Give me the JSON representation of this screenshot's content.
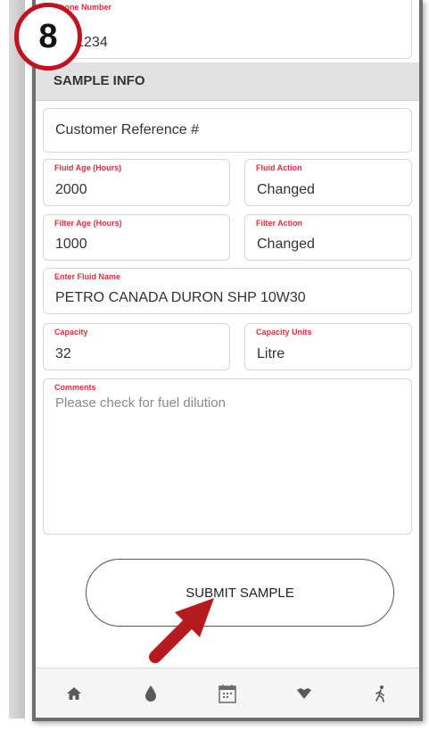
{
  "phone_field": {
    "label": "Phone Number",
    "value": "56-1234"
  },
  "section_title": "SAMPLE INFO",
  "customer_ref": {
    "value": "Customer Reference #"
  },
  "fluid_age": {
    "label": "Fluid Age (Hours)",
    "value": "2000"
  },
  "fluid_action": {
    "label": "Fluid Action",
    "value": "Changed"
  },
  "filter_age": {
    "label": "Filter Age (Hours)",
    "value": "1000"
  },
  "filter_action": {
    "label": "Filter Action",
    "value": "Changed"
  },
  "fluid_name": {
    "label": "Enter Fluid Name",
    "value": "PETRO CANADA DURON SHP 10W30"
  },
  "capacity": {
    "label": "Capacity",
    "value": "32"
  },
  "capacity_units": {
    "label": "Capacity Units",
    "value": "Litre"
  },
  "comments": {
    "label": "Comments",
    "placeholder": "Please check for fuel dilution"
  },
  "submit_label": "SUBMIT SAMPLE",
  "nav": [
    {
      "icon": "home-icon"
    },
    {
      "icon": "drop-icon"
    },
    {
      "icon": "calendar-icon"
    },
    {
      "icon": "heart-icon"
    },
    {
      "icon": "walk-icon"
    }
  ],
  "step_badge": "8",
  "colors": {
    "label_red": "#e0303c",
    "badge_red": "#c1121f",
    "header_gray": "#e2e2e2"
  }
}
